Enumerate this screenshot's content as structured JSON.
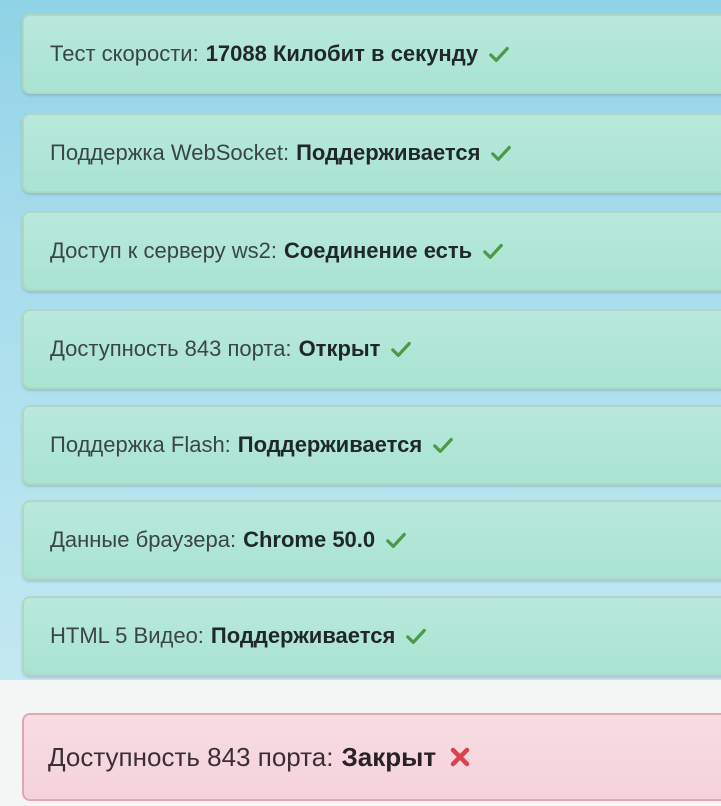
{
  "checks": [
    {
      "label": "Тест скорости:",
      "value": "17088 Килобит в секунду",
      "status_icon": "check-icon"
    },
    {
      "label": "Поддержка WebSocket:",
      "value": "Поддерживается",
      "status_icon": "check-icon"
    },
    {
      "label": "Доступ к серверу ws2:",
      "value": "Соединение есть",
      "status_icon": "check-icon"
    },
    {
      "label": "Доступность 843 порта:",
      "value": "Открыт",
      "status_icon": "check-icon"
    },
    {
      "label": "Поддержка Flash:",
      "value": "Поддерживается",
      "status_icon": "check-icon"
    },
    {
      "label": "Данные браузера:",
      "value": "Chrome 50.0",
      "status_icon": "check-icon"
    },
    {
      "label": "HTML 5 Видео:",
      "value": "Поддерживается",
      "status_icon": "check-icon"
    }
  ],
  "error_check": {
    "label": "Доступность 843 порта:",
    "value": "Закрыт",
    "status_icon": "cross-icon"
  },
  "colors": {
    "success": "#4a9a48",
    "error": "#d9454d",
    "success_row_bg": "#b2e6d6",
    "error_row_bg": "#f6d7df",
    "panel_bg": "#a7dcec"
  }
}
